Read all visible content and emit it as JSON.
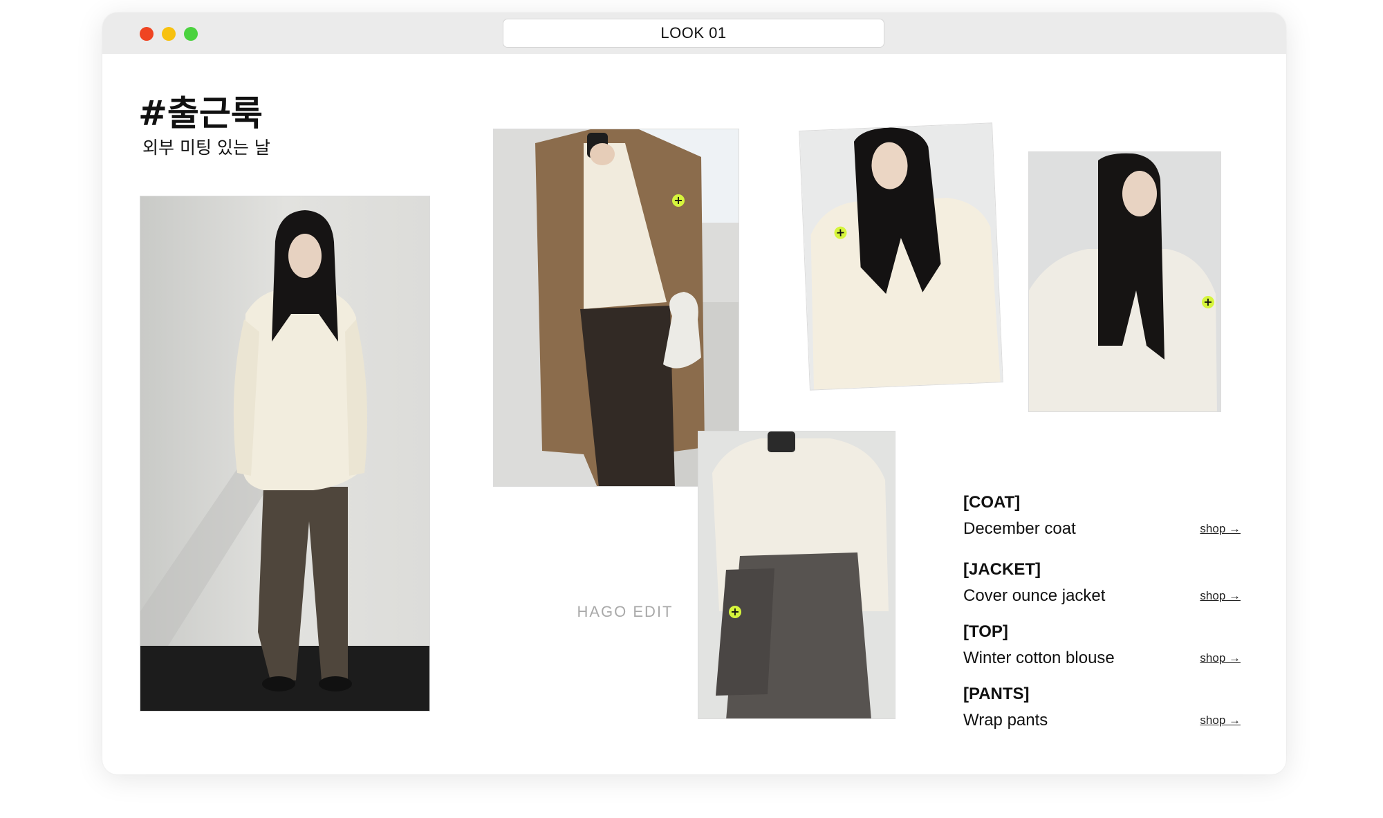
{
  "window": {
    "title": "LOOK 01",
    "traffic_lights": [
      "close",
      "minimize",
      "maximize"
    ],
    "colors": {
      "close": "#ef4422",
      "minimize": "#f7c10f",
      "maximize": "#4bd23f"
    }
  },
  "header": {
    "title": "#출근룩",
    "subtitle": "외부 미팅 있는 날"
  },
  "brand_watermark": "HAGO EDIT",
  "accent_color": "#d6f53c",
  "hotspot_symbol": "+",
  "products": [
    {
      "category": "[COAT]",
      "name": "December coat",
      "link": "shop →"
    },
    {
      "category": "[JACKET]",
      "name": "Cover ounce jacket",
      "link": "shop →"
    },
    {
      "category": "[TOP]",
      "name": "Winter cotton blouse",
      "link": "shop →"
    },
    {
      "category": "[PANTS]",
      "name": "Wrap pants",
      "link": "shop →"
    }
  ]
}
